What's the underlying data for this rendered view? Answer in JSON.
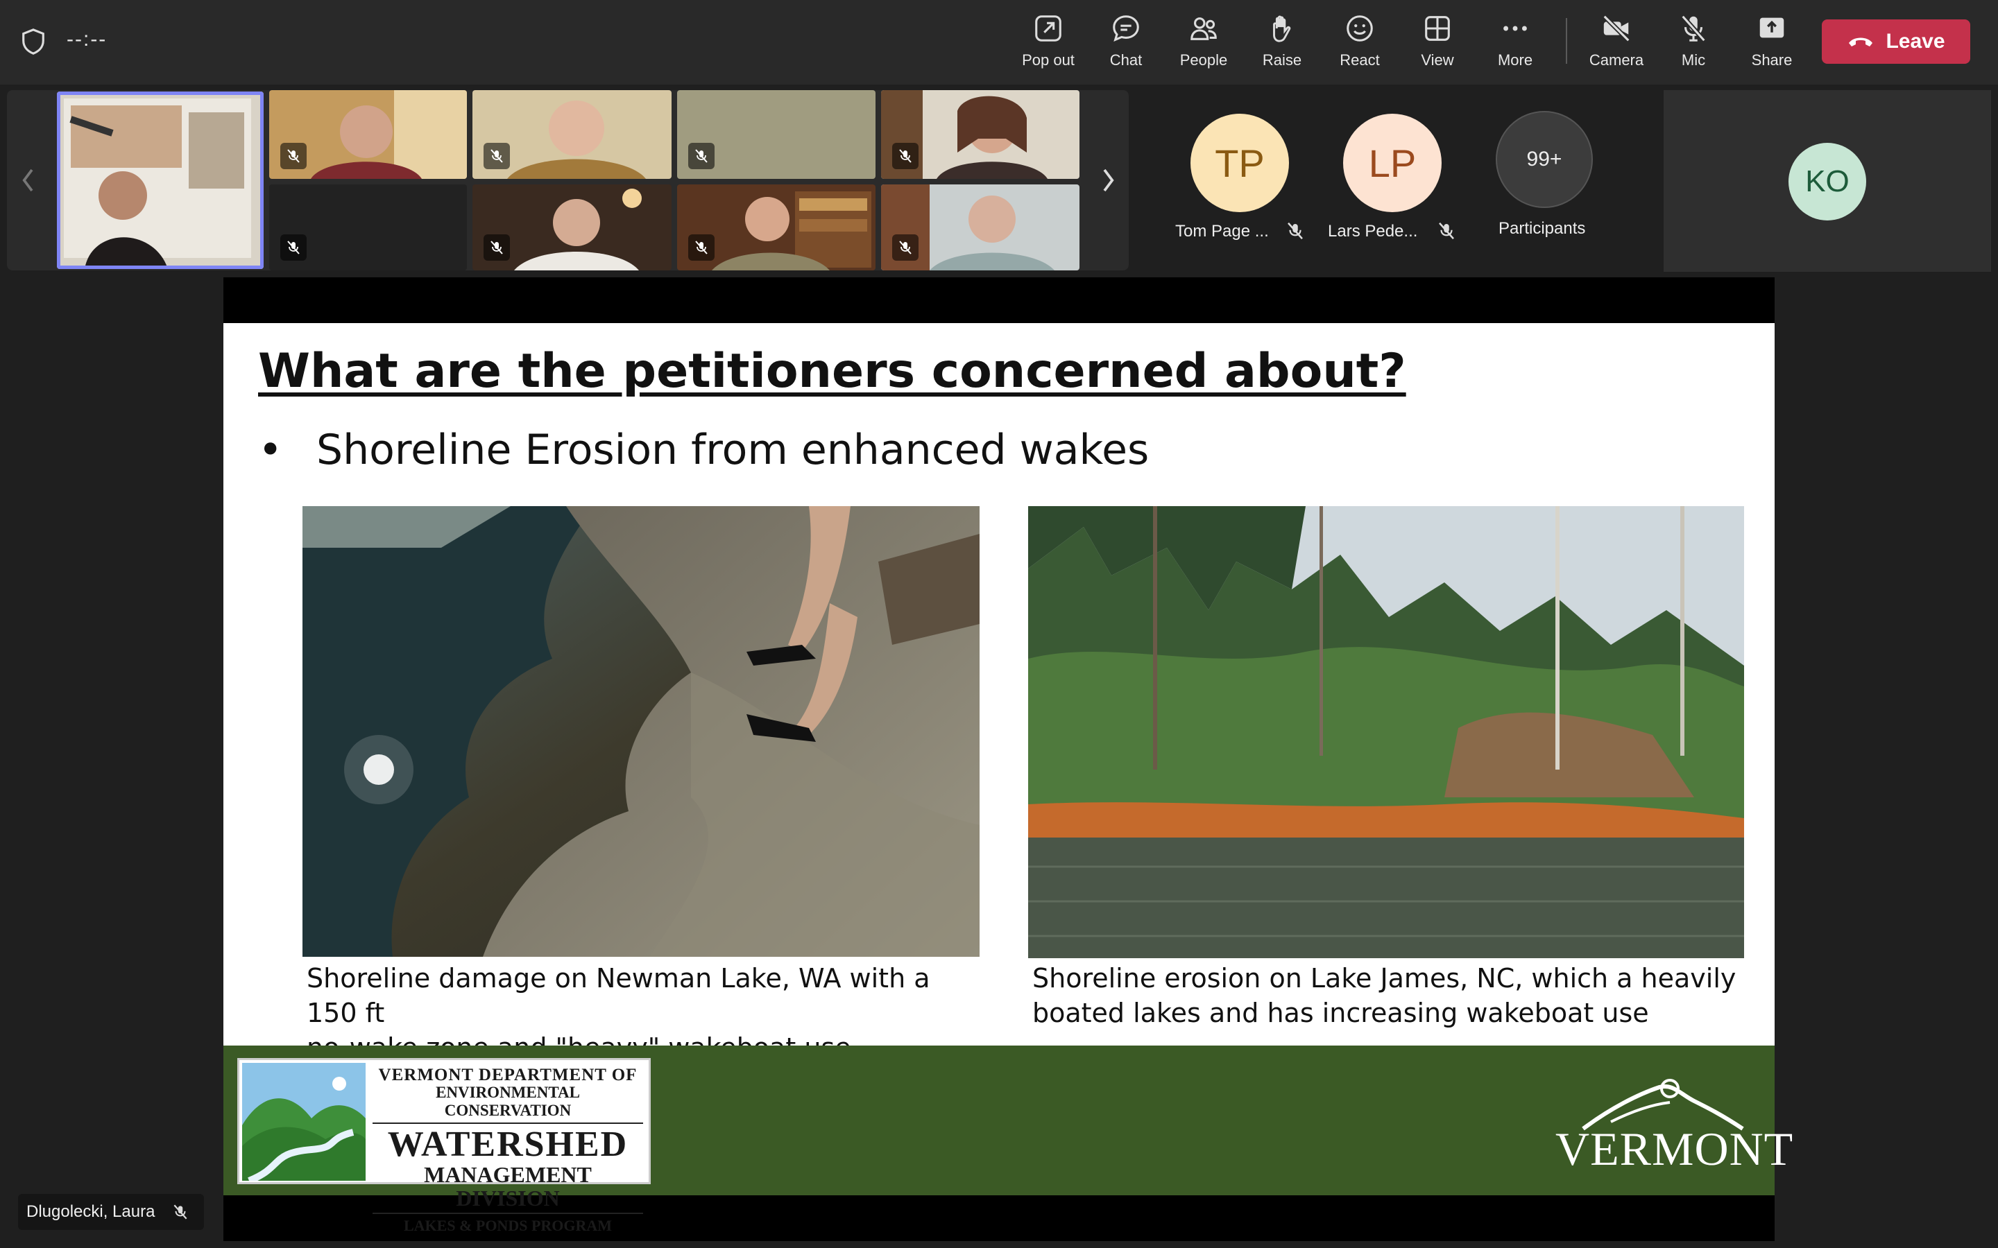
{
  "topbar": {
    "timer": "--:--",
    "buttons": [
      {
        "id": "popout",
        "label": "Pop out",
        "icon": "pop-out-icon"
      },
      {
        "id": "chat",
        "label": "Chat",
        "icon": "chat-icon"
      },
      {
        "id": "people",
        "label": "People",
        "icon": "people-icon"
      },
      {
        "id": "raise",
        "label": "Raise",
        "icon": "hand-icon"
      },
      {
        "id": "react",
        "label": "React",
        "icon": "smiley-icon"
      },
      {
        "id": "view",
        "label": "View",
        "icon": "grid-icon"
      },
      {
        "id": "more",
        "label": "More",
        "icon": "ellipsis-icon"
      },
      {
        "id": "camera",
        "label": "Camera",
        "icon": "camera-off-icon"
      },
      {
        "id": "mic",
        "label": "Mic",
        "icon": "mic-off-icon"
      },
      {
        "id": "share",
        "label": "Share",
        "icon": "share-icon"
      }
    ],
    "leave_label": "Leave",
    "leave_color": "#c4314b"
  },
  "participants": {
    "tp": {
      "initials": "TP",
      "name": "Tom Page ..."
    },
    "lp": {
      "initials": "LP",
      "name": "Lars Pede..."
    },
    "overflow": {
      "count": "99+",
      "label": "Participants"
    },
    "ko": {
      "initials": "KO"
    }
  },
  "slide": {
    "title": "What are the petitioners concerned about?",
    "bullet_char": "•",
    "bullet": "Shoreline Erosion from enhanced wakes",
    "caption_left_1": "Shoreline damage on Newman Lake, WA with a 150 ft",
    "caption_left_2": "no-wake zone and \"heavy\" wakeboat use",
    "caption_right_1": "Shoreline erosion on Lake James, NC, which a heavily",
    "caption_right_2": "boated lakes and has increasing wakeboat use",
    "logo": {
      "line1": "VERMONT DEPARTMENT OF",
      "line2": "ENVIRONMENTAL CONSERVATION",
      "line3": "WATERSHED",
      "line4": "MANAGEMENT DIVISION",
      "line5": "LAKES & PONDS PROGRAM"
    },
    "vermont": "VERMONT",
    "footer_color": "#3b5a25"
  },
  "presenter": {
    "name": "Dlugolecki, Laura"
  }
}
